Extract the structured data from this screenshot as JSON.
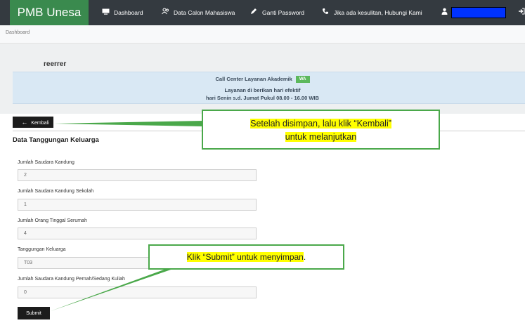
{
  "navbar": {
    "brand": "PMB Unesa",
    "items": [
      {
        "label": "Dashboard",
        "icon": "monitor-icon"
      },
      {
        "label": "Data Calon Mahasiswa",
        "icon": "users-icon"
      },
      {
        "label": "Ganti Password",
        "icon": "pencil-icon"
      },
      {
        "label": "Jika ada kesulitan, Hubungi Kami",
        "icon": "phone-icon"
      }
    ],
    "user_icon": "user-icon",
    "logout_icon": "logout-icon",
    "user_box_color": "#0032ff",
    "accent": "#3a8a4e"
  },
  "breadcrumb": "Dashboard",
  "profile": {
    "username": "reerrer"
  },
  "call_center": {
    "line1": "Call Center Layanan Akademik",
    "wa": "WA",
    "line2": "Layanan di berikan hari efektif",
    "line3": "hari Senin s.d. Jumat Pukul 08.00 - 16.00 WIB"
  },
  "back_button": "Kembali",
  "section_title": "Data Tanggungan Keluarga",
  "form": {
    "fields": [
      {
        "label": "Jumlah Saudara Kandung",
        "value": "2"
      },
      {
        "label": "Jumlah Saudara Kandung Sekolah",
        "value": "1"
      },
      {
        "label": "Jumlah Orang Tinggal Serumah",
        "value": "4"
      },
      {
        "label": "Tanggungan Keluarga",
        "value": "T03"
      },
      {
        "label": "Jumlah Saudara Kandung Pernah/Sedang Kuliah",
        "value": "0"
      }
    ],
    "submit": "Submit"
  },
  "callouts": {
    "kembali_line1": "Setelah disimpan, lalu klik “Kembali”",
    "kembali_line2": "untuk melanjutkan",
    "submit": "Klik “Submit” untuk menyimpan",
    "submit_period": "."
  }
}
